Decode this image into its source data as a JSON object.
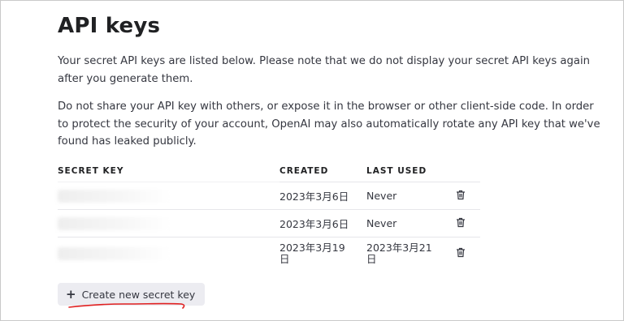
{
  "page": {
    "title": "API keys",
    "description_1": "Your secret API keys are listed below. Please note that we do not display your secret API keys again after you generate them.",
    "description_2": "Do not share your API key with others, or expose it in the browser or other client-side code. In order to protect the security of your account, OpenAI may also automatically rotate any API key that we've found has leaked publicly."
  },
  "table": {
    "headers": {
      "key": "SECRET KEY",
      "created": "CREATED",
      "last_used": "LAST USED"
    },
    "rows": [
      {
        "key": "sk-...7tJt",
        "created": "2023年3月6日",
        "last_used": "Never"
      },
      {
        "key": "sk-...7tJt",
        "created": "2023年3月6日",
        "last_used": "Never"
      },
      {
        "key": "sk-...3RkO",
        "created": "2023年3月19日",
        "last_used": "2023年3月21日"
      }
    ]
  },
  "actions": {
    "create_label": "Create new secret key",
    "create_icon": "plus-icon",
    "delete_icon": "trash-icon"
  },
  "colors": {
    "button_bg": "#ececf1",
    "annotation": "#e02020"
  }
}
